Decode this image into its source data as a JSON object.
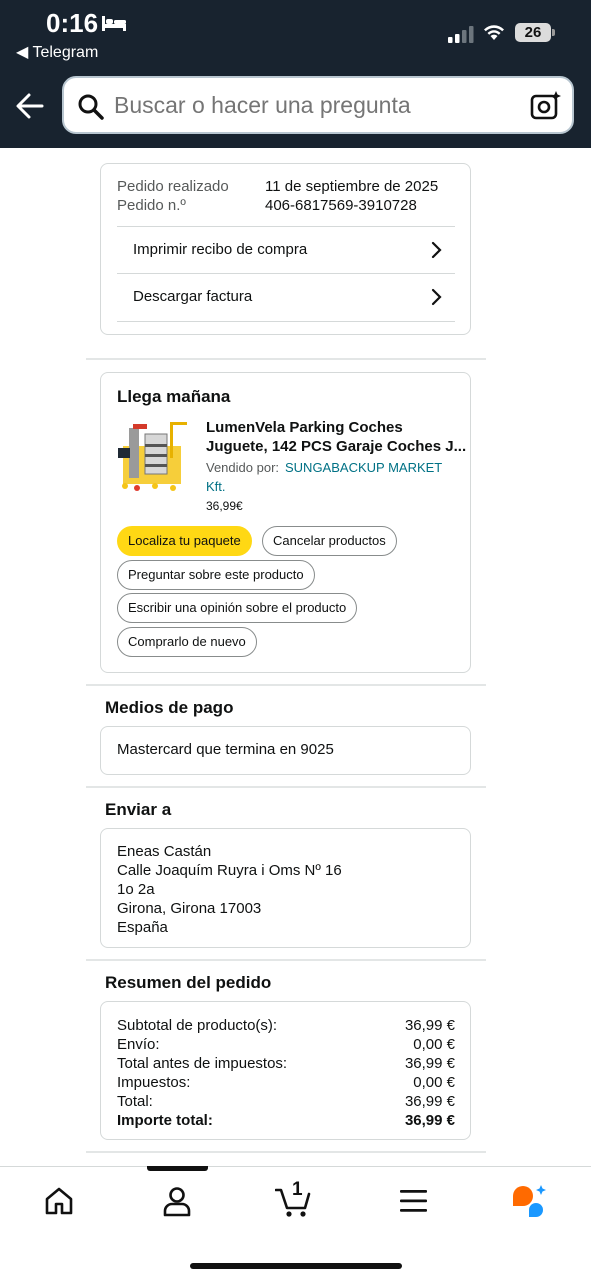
{
  "status": {
    "time": "0:16",
    "back_app": "◀ Telegram",
    "battery": "26"
  },
  "search": {
    "placeholder": "Buscar o hacer una pregunta"
  },
  "order": {
    "placed_label": "Pedido realizado",
    "placed_value": "11 de septiembre de 2025",
    "number_label": "Pedido n.º",
    "number_value": "406-6817569-3910728",
    "links": [
      "Imprimir recibo de compra",
      "Descargar factura"
    ]
  },
  "delivery": {
    "title": "Llega mañana",
    "product_name_1": "LumenVela Parking Coches",
    "product_name_2": "Juguete, 142 PCS Garaje Coches J...",
    "sold_by_label": "Vendido por:",
    "seller_1": "SUNGABACKUP MARKET",
    "seller_2": "Kft.",
    "price": "36,99€",
    "actions": {
      "track": "Localiza tu paquete",
      "cancel": "Cancelar productos",
      "ask": "Preguntar sobre este producto",
      "review": "Escribir una opinión sobre el producto",
      "rebuy": "Comprarlo de nuevo"
    }
  },
  "payment": {
    "title": "Medios de pago",
    "method": "Mastercard  que termina en 9025"
  },
  "shipping": {
    "title": "Enviar a",
    "lines": [
      "Eneas Castán",
      "Calle Joaquím Ruyra i Oms Nº 16",
      "1o 2a",
      "Girona, Girona 17003",
      "España"
    ]
  },
  "summary": {
    "title": "Resumen del pedido",
    "rows": [
      {
        "label": "Subtotal de producto(s):",
        "value": "36,99 €"
      },
      {
        "label": "Envío:",
        "value": "0,00 €"
      },
      {
        "label": "Total antes de impuestos:",
        "value": "36,99 €"
      },
      {
        "label": "Impuestos:",
        "value": "0,00 €"
      },
      {
        "label": "Total:",
        "value": "36,99 €"
      },
      {
        "label": "Importe total:",
        "value": "36,99 €"
      }
    ]
  },
  "nav": {
    "cart_count": "1"
  },
  "colors": {
    "header_bg": "#18232f",
    "link": "#007185",
    "primary_button": "#ffd814",
    "accent_orange": "#ff6a00",
    "accent_blue": "#1a98ff"
  }
}
